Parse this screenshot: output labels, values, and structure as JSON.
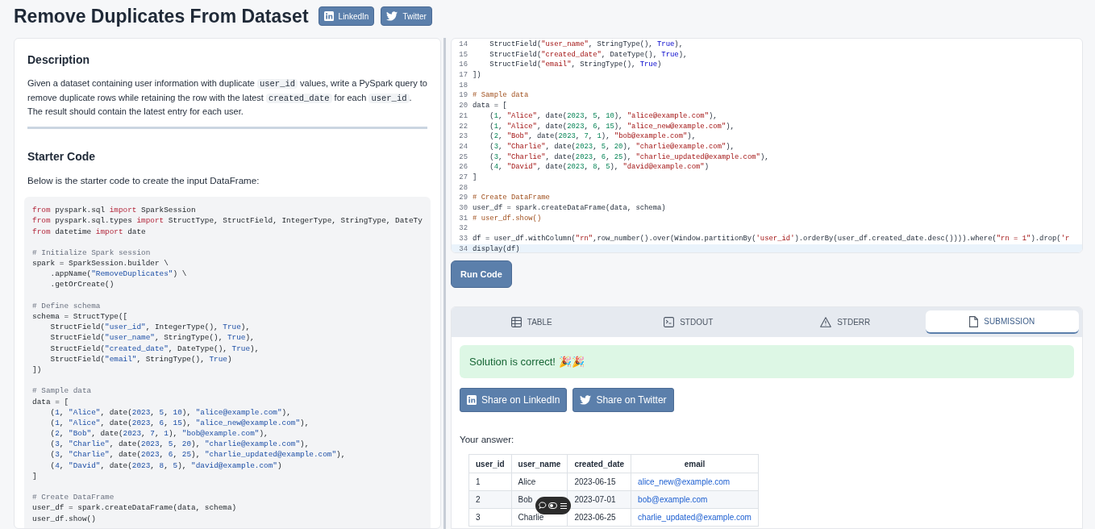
{
  "header": {
    "title": "Remove Duplicates From Dataset",
    "share_buttons": [
      {
        "kind": "linkedin",
        "label": "LinkedIn"
      },
      {
        "kind": "twitter",
        "label": "Twitter"
      }
    ]
  },
  "description": {
    "heading": "Description",
    "paragraph": [
      {
        "kind": "text",
        "text": "Given a dataset containing user information with duplicate "
      },
      {
        "kind": "code",
        "text": "user_id"
      },
      {
        "kind": "text",
        "text": " values, write a PySpark query to remove duplicate rows while retaining the row with the latest "
      },
      {
        "kind": "code",
        "text": "created_date"
      },
      {
        "kind": "text",
        "text": " for each "
      },
      {
        "kind": "code",
        "text": "user_id"
      },
      {
        "kind": "text",
        "text": ". The result should contain the latest entry for each user."
      }
    ]
  },
  "starter": {
    "heading": "Starter Code",
    "intro": "Below is the starter code to create the input DataFrame:",
    "lines": [
      {
        "kind": "code",
        "segments": [
          {
            "kind": "keyword",
            "text": "from"
          },
          {
            "kind": "plain",
            "text": " pyspark.sql "
          },
          {
            "kind": "keyword",
            "text": "import"
          },
          {
            "kind": "plain",
            "text": " SparkSession"
          }
        ]
      },
      {
        "kind": "code",
        "segments": [
          {
            "kind": "keyword",
            "text": "from"
          },
          {
            "kind": "plain",
            "text": " pyspark.sql.types "
          },
          {
            "kind": "keyword",
            "text": "import"
          },
          {
            "kind": "plain",
            "text": " StructType, StructField, IntegerType, StringType, DateTy"
          }
        ]
      },
      {
        "kind": "code",
        "segments": [
          {
            "kind": "keyword",
            "text": "from"
          },
          {
            "kind": "plain",
            "text": " datetime "
          },
          {
            "kind": "keyword",
            "text": "import"
          },
          {
            "kind": "plain",
            "text": " date"
          }
        ]
      },
      {
        "kind": "blank"
      },
      {
        "kind": "code",
        "segments": [
          {
            "kind": "comment",
            "text": "# Initialize Spark session"
          }
        ]
      },
      {
        "kind": "code",
        "segments": [
          {
            "kind": "plain",
            "text": "spark = SparkSession.builder \\"
          }
        ]
      },
      {
        "kind": "code",
        "segments": [
          {
            "kind": "plain",
            "text": "    .appName("
          },
          {
            "kind": "string",
            "text": "\"RemoveDuplicates\""
          },
          {
            "kind": "plain",
            "text": ") \\"
          }
        ]
      },
      {
        "kind": "code",
        "segments": [
          {
            "kind": "plain",
            "text": "    .getOrCreate()"
          }
        ]
      },
      {
        "kind": "blank"
      },
      {
        "kind": "code",
        "segments": [
          {
            "kind": "comment",
            "text": "# Define schema"
          }
        ]
      },
      {
        "kind": "code",
        "segments": [
          {
            "kind": "plain",
            "text": "schema = StructType(["
          }
        ]
      },
      {
        "kind": "code",
        "segments": [
          {
            "kind": "plain",
            "text": "    StructField("
          },
          {
            "kind": "string",
            "text": "\"user_id\""
          },
          {
            "kind": "plain",
            "text": ", IntegerType(), "
          },
          {
            "kind": "boolean",
            "text": "True"
          },
          {
            "kind": "plain",
            "text": "),"
          }
        ]
      },
      {
        "kind": "code",
        "segments": [
          {
            "kind": "plain",
            "text": "    StructField("
          },
          {
            "kind": "string",
            "text": "\"user_name\""
          },
          {
            "kind": "plain",
            "text": ", StringType(), "
          },
          {
            "kind": "boolean",
            "text": "True"
          },
          {
            "kind": "plain",
            "text": "),"
          }
        ]
      },
      {
        "kind": "code",
        "segments": [
          {
            "kind": "plain",
            "text": "    StructField("
          },
          {
            "kind": "string",
            "text": "\"created_date\""
          },
          {
            "kind": "plain",
            "text": ", DateType(), "
          },
          {
            "kind": "boolean",
            "text": "True"
          },
          {
            "kind": "plain",
            "text": "),"
          }
        ]
      },
      {
        "kind": "code",
        "segments": [
          {
            "kind": "plain",
            "text": "    StructField("
          },
          {
            "kind": "string",
            "text": "\"email\""
          },
          {
            "kind": "plain",
            "text": ", StringType(), "
          },
          {
            "kind": "boolean",
            "text": "True"
          },
          {
            "kind": "plain",
            "text": ")"
          }
        ]
      },
      {
        "kind": "code",
        "segments": [
          {
            "kind": "plain",
            "text": "])"
          }
        ]
      },
      {
        "kind": "blank"
      },
      {
        "kind": "code",
        "segments": [
          {
            "kind": "comment",
            "text": "# Sample data"
          }
        ]
      },
      {
        "kind": "code",
        "segments": [
          {
            "kind": "plain",
            "text": "data = ["
          }
        ]
      },
      {
        "kind": "code",
        "segments": [
          {
            "kind": "plain",
            "text": "    ("
          },
          {
            "kind": "number",
            "text": "1"
          },
          {
            "kind": "plain",
            "text": ", "
          },
          {
            "kind": "string",
            "text": "\"Alice\""
          },
          {
            "kind": "plain",
            "text": ", date("
          },
          {
            "kind": "number",
            "text": "2023"
          },
          {
            "kind": "plain",
            "text": ", "
          },
          {
            "kind": "number",
            "text": "5"
          },
          {
            "kind": "plain",
            "text": ", "
          },
          {
            "kind": "number",
            "text": "10"
          },
          {
            "kind": "plain",
            "text": "), "
          },
          {
            "kind": "string",
            "text": "\"alice@example.com\""
          },
          {
            "kind": "plain",
            "text": "),"
          }
        ]
      },
      {
        "kind": "code",
        "segments": [
          {
            "kind": "plain",
            "text": "    ("
          },
          {
            "kind": "number",
            "text": "1"
          },
          {
            "kind": "plain",
            "text": ", "
          },
          {
            "kind": "string",
            "text": "\"Alice\""
          },
          {
            "kind": "plain",
            "text": ", date("
          },
          {
            "kind": "number",
            "text": "2023"
          },
          {
            "kind": "plain",
            "text": ", "
          },
          {
            "kind": "number",
            "text": "6"
          },
          {
            "kind": "plain",
            "text": ", "
          },
          {
            "kind": "number",
            "text": "15"
          },
          {
            "kind": "plain",
            "text": "), "
          },
          {
            "kind": "string",
            "text": "\"alice_new@example.com\""
          },
          {
            "kind": "plain",
            "text": "),"
          }
        ]
      },
      {
        "kind": "code",
        "segments": [
          {
            "kind": "plain",
            "text": "    ("
          },
          {
            "kind": "number",
            "text": "2"
          },
          {
            "kind": "plain",
            "text": ", "
          },
          {
            "kind": "string",
            "text": "\"Bob\""
          },
          {
            "kind": "plain",
            "text": ", date("
          },
          {
            "kind": "number",
            "text": "2023"
          },
          {
            "kind": "plain",
            "text": ", "
          },
          {
            "kind": "number",
            "text": "7"
          },
          {
            "kind": "plain",
            "text": ", "
          },
          {
            "kind": "number",
            "text": "1"
          },
          {
            "kind": "plain",
            "text": "), "
          },
          {
            "kind": "string",
            "text": "\"bob@example.com\""
          },
          {
            "kind": "plain",
            "text": "),"
          }
        ]
      },
      {
        "kind": "code",
        "segments": [
          {
            "kind": "plain",
            "text": "    ("
          },
          {
            "kind": "number",
            "text": "3"
          },
          {
            "kind": "plain",
            "text": ", "
          },
          {
            "kind": "string",
            "text": "\"Charlie\""
          },
          {
            "kind": "plain",
            "text": ", date("
          },
          {
            "kind": "number",
            "text": "2023"
          },
          {
            "kind": "plain",
            "text": ", "
          },
          {
            "kind": "number",
            "text": "5"
          },
          {
            "kind": "plain",
            "text": ", "
          },
          {
            "kind": "number",
            "text": "20"
          },
          {
            "kind": "plain",
            "text": "), "
          },
          {
            "kind": "string",
            "text": "\"charlie@example.com\""
          },
          {
            "kind": "plain",
            "text": "),"
          }
        ]
      },
      {
        "kind": "code",
        "segments": [
          {
            "kind": "plain",
            "text": "    ("
          },
          {
            "kind": "number",
            "text": "3"
          },
          {
            "kind": "plain",
            "text": ", "
          },
          {
            "kind": "string",
            "text": "\"Charlie\""
          },
          {
            "kind": "plain",
            "text": ", date("
          },
          {
            "kind": "number",
            "text": "2023"
          },
          {
            "kind": "plain",
            "text": ", "
          },
          {
            "kind": "number",
            "text": "6"
          },
          {
            "kind": "plain",
            "text": ", "
          },
          {
            "kind": "number",
            "text": "25"
          },
          {
            "kind": "plain",
            "text": "), "
          },
          {
            "kind": "string",
            "text": "\"charlie_updated@example.com\""
          },
          {
            "kind": "plain",
            "text": "),"
          }
        ]
      },
      {
        "kind": "code",
        "segments": [
          {
            "kind": "plain",
            "text": "    ("
          },
          {
            "kind": "number",
            "text": "4"
          },
          {
            "kind": "plain",
            "text": ", "
          },
          {
            "kind": "string",
            "text": "\"David\""
          },
          {
            "kind": "plain",
            "text": ", date("
          },
          {
            "kind": "number",
            "text": "2023"
          },
          {
            "kind": "plain",
            "text": ", "
          },
          {
            "kind": "number",
            "text": "8"
          },
          {
            "kind": "plain",
            "text": ", "
          },
          {
            "kind": "number",
            "text": "5"
          },
          {
            "kind": "plain",
            "text": "), "
          },
          {
            "kind": "string",
            "text": "\"david@example.com\""
          },
          {
            "kind": "plain",
            "text": ")"
          }
        ]
      },
      {
        "kind": "code",
        "segments": [
          {
            "kind": "plain",
            "text": "]"
          }
        ]
      },
      {
        "kind": "blank"
      },
      {
        "kind": "code",
        "segments": [
          {
            "kind": "comment",
            "text": "# Create DataFrame"
          }
        ]
      },
      {
        "kind": "code",
        "segments": [
          {
            "kind": "plain",
            "text": "user_df = spark.createDataFrame(data, schema)"
          }
        ]
      },
      {
        "kind": "code",
        "segments": [
          {
            "kind": "plain",
            "text": "user_df.show()"
          }
        ]
      }
    ]
  },
  "editor": {
    "lines": [
      {
        "number": "14",
        "active": false,
        "code": [
          {
            "kind": "plain",
            "text": "    StructField("
          },
          {
            "kind": "string",
            "text": "\"user_name\""
          },
          {
            "kind": "plain",
            "text": ", StringType(), "
          },
          {
            "kind": "boolean",
            "text": "True"
          },
          {
            "kind": "plain",
            "text": "),"
          }
        ]
      },
      {
        "number": "15",
        "active": false,
        "code": [
          {
            "kind": "plain",
            "text": "    StructField("
          },
          {
            "kind": "string",
            "text": "\"created_date\""
          },
          {
            "kind": "plain",
            "text": ", DateType(), "
          },
          {
            "kind": "boolean",
            "text": "True"
          },
          {
            "kind": "plain",
            "text": "),"
          }
        ]
      },
      {
        "number": "16",
        "active": false,
        "code": [
          {
            "kind": "plain",
            "text": "    StructField("
          },
          {
            "kind": "string",
            "text": "\"email\""
          },
          {
            "kind": "plain",
            "text": ", StringType(), "
          },
          {
            "kind": "boolean",
            "text": "True"
          },
          {
            "kind": "plain",
            "text": ")"
          }
        ]
      },
      {
        "number": "17",
        "active": false,
        "code": [
          {
            "kind": "plain",
            "text": "])"
          }
        ]
      },
      {
        "number": "18",
        "active": false
      },
      {
        "number": "19",
        "active": false,
        "code": [
          {
            "kind": "comment",
            "text": "# Sample data"
          }
        ]
      },
      {
        "number": "20",
        "active": false,
        "code": [
          {
            "kind": "plain",
            "text": "data = ["
          }
        ]
      },
      {
        "number": "21",
        "active": false,
        "code": [
          {
            "kind": "plain",
            "text": "    ("
          },
          {
            "kind": "number",
            "text": "1"
          },
          {
            "kind": "plain",
            "text": ", "
          },
          {
            "kind": "string",
            "text": "\"Alice\""
          },
          {
            "kind": "plain",
            "text": ", date("
          },
          {
            "kind": "number",
            "text": "2023"
          },
          {
            "kind": "plain",
            "text": ", "
          },
          {
            "kind": "number",
            "text": "5"
          },
          {
            "kind": "plain",
            "text": ", "
          },
          {
            "kind": "number",
            "text": "10"
          },
          {
            "kind": "plain",
            "text": "), "
          },
          {
            "kind": "string",
            "text": "\"alice@example.com\""
          },
          {
            "kind": "plain",
            "text": "),"
          }
        ]
      },
      {
        "number": "22",
        "active": false,
        "code": [
          {
            "kind": "plain",
            "text": "    ("
          },
          {
            "kind": "number",
            "text": "1"
          },
          {
            "kind": "plain",
            "text": ", "
          },
          {
            "kind": "string",
            "text": "\"Alice\""
          },
          {
            "kind": "plain",
            "text": ", date("
          },
          {
            "kind": "number",
            "text": "2023"
          },
          {
            "kind": "plain",
            "text": ", "
          },
          {
            "kind": "number",
            "text": "6"
          },
          {
            "kind": "plain",
            "text": ", "
          },
          {
            "kind": "number",
            "text": "15"
          },
          {
            "kind": "plain",
            "text": "), "
          },
          {
            "kind": "string",
            "text": "\"alice_new@example.com\""
          },
          {
            "kind": "plain",
            "text": "),"
          }
        ]
      },
      {
        "number": "23",
        "active": false,
        "code": [
          {
            "kind": "plain",
            "text": "    ("
          },
          {
            "kind": "number",
            "text": "2"
          },
          {
            "kind": "plain",
            "text": ", "
          },
          {
            "kind": "string",
            "text": "\"Bob\""
          },
          {
            "kind": "plain",
            "text": ", date("
          },
          {
            "kind": "number",
            "text": "2023"
          },
          {
            "kind": "plain",
            "text": ", "
          },
          {
            "kind": "number",
            "text": "7"
          },
          {
            "kind": "plain",
            "text": ", "
          },
          {
            "kind": "number",
            "text": "1"
          },
          {
            "kind": "plain",
            "text": "), "
          },
          {
            "kind": "string",
            "text": "\"bob@example.com\""
          },
          {
            "kind": "plain",
            "text": "),"
          }
        ]
      },
      {
        "number": "24",
        "active": false,
        "code": [
          {
            "kind": "plain",
            "text": "    ("
          },
          {
            "kind": "number",
            "text": "3"
          },
          {
            "kind": "plain",
            "text": ", "
          },
          {
            "kind": "string",
            "text": "\"Charlie\""
          },
          {
            "kind": "plain",
            "text": ", date("
          },
          {
            "kind": "number",
            "text": "2023"
          },
          {
            "kind": "plain",
            "text": ", "
          },
          {
            "kind": "number",
            "text": "5"
          },
          {
            "kind": "plain",
            "text": ", "
          },
          {
            "kind": "number",
            "text": "20"
          },
          {
            "kind": "plain",
            "text": "), "
          },
          {
            "kind": "string",
            "text": "\"charlie@example.com\""
          },
          {
            "kind": "plain",
            "text": "),"
          }
        ]
      },
      {
        "number": "25",
        "active": false,
        "code": [
          {
            "kind": "plain",
            "text": "    ("
          },
          {
            "kind": "number",
            "text": "3"
          },
          {
            "kind": "plain",
            "text": ", "
          },
          {
            "kind": "string",
            "text": "\"Charlie\""
          },
          {
            "kind": "plain",
            "text": ", date("
          },
          {
            "kind": "number",
            "text": "2023"
          },
          {
            "kind": "plain",
            "text": ", "
          },
          {
            "kind": "number",
            "text": "6"
          },
          {
            "kind": "plain",
            "text": ", "
          },
          {
            "kind": "number",
            "text": "25"
          },
          {
            "kind": "plain",
            "text": "), "
          },
          {
            "kind": "string",
            "text": "\"charlie_updated@example.com\""
          },
          {
            "kind": "plain",
            "text": "),"
          }
        ]
      },
      {
        "number": "26",
        "active": false,
        "code": [
          {
            "kind": "plain",
            "text": "    ("
          },
          {
            "kind": "number",
            "text": "4"
          },
          {
            "kind": "plain",
            "text": ", "
          },
          {
            "kind": "string",
            "text": "\"David\""
          },
          {
            "kind": "plain",
            "text": ", date("
          },
          {
            "kind": "number",
            "text": "2023"
          },
          {
            "kind": "plain",
            "text": ", "
          },
          {
            "kind": "number",
            "text": "8"
          },
          {
            "kind": "plain",
            "text": ", "
          },
          {
            "kind": "number",
            "text": "5"
          },
          {
            "kind": "plain",
            "text": "), "
          },
          {
            "kind": "string",
            "text": "\"david@example.com\""
          },
          {
            "kind": "plain",
            "text": ")"
          }
        ]
      },
      {
        "number": "27",
        "active": false,
        "code": [
          {
            "kind": "plain",
            "text": "]"
          }
        ]
      },
      {
        "number": "28",
        "active": false
      },
      {
        "number": "29",
        "active": false,
        "code": [
          {
            "kind": "comment",
            "text": "# Create DataFrame"
          }
        ]
      },
      {
        "number": "30",
        "active": false,
        "code": [
          {
            "kind": "plain",
            "text": "user_df = spark.createDataFrame(data, schema)"
          }
        ]
      },
      {
        "number": "31",
        "active": false,
        "code": [
          {
            "kind": "comment",
            "text": "# user_df.show()"
          }
        ]
      },
      {
        "number": "32",
        "active": false
      },
      {
        "number": "33",
        "active": false,
        "code": [
          {
            "kind": "plain",
            "text": "df = user_df.withColumn("
          },
          {
            "kind": "string",
            "text": "\"rn\""
          },
          {
            "kind": "plain",
            "text": ",row_number().over(Window.partitionBy("
          },
          {
            "kind": "string",
            "text": "'user_id'"
          },
          {
            "kind": "plain",
            "text": ").orderBy(user_df.created_date.desc()))).where("
          },
          {
            "kind": "string",
            "text": "\"rn = 1\""
          },
          {
            "kind": "plain",
            "text": ").drop("
          },
          {
            "kind": "string",
            "text": "'r"
          }
        ]
      },
      {
        "number": "34",
        "active": true,
        "code": [
          {
            "kind": "plain",
            "text": "display(df)"
          }
        ]
      }
    ]
  },
  "run_button": "Run Code",
  "results": {
    "tabs": [
      {
        "kind": "table",
        "label": "TABLE",
        "selected": false
      },
      {
        "kind": "stdout",
        "label": "STDOUT",
        "selected": false
      },
      {
        "kind": "stderr",
        "label": "STDERR",
        "selected": false
      },
      {
        "kind": "submission",
        "label": "SUBMISSION",
        "selected": true
      }
    ],
    "message": "Solution is correct! 🎉🎉",
    "share_buttons": [
      {
        "kind": "linkedin",
        "label": "Share on LinkedIn"
      },
      {
        "kind": "twitter",
        "label": "Share on Twitter"
      }
    ],
    "answer_label": "Your answer:",
    "table": {
      "columns": [
        "user_id",
        "user_name",
        "created_date",
        "email"
      ],
      "rows": [
        [
          "1",
          "Alice",
          "2023-06-15",
          "alice_new@example.com"
        ],
        [
          "2",
          "Bob",
          "2023-07-01",
          "bob@example.com"
        ],
        [
          "3",
          "Charlie",
          "2023-06-25",
          "charlie_updated@example.com"
        ]
      ]
    }
  }
}
